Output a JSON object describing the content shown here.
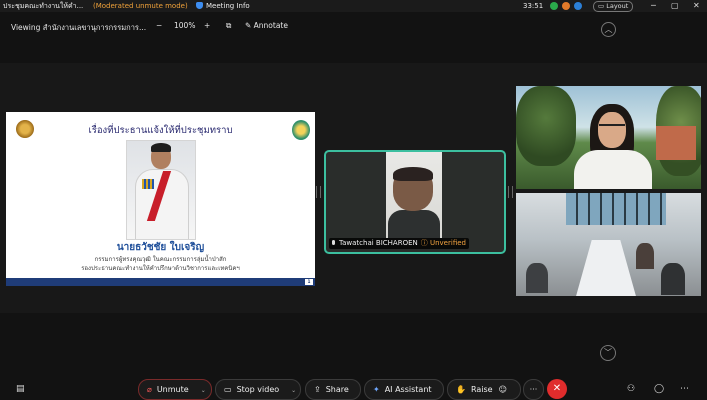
{
  "titlebar": {
    "meeting_title": "ประชุมคณะทำงานให้คำ...",
    "moderation": "(Moderated unmute mode)",
    "meeting_info": "Meeting Info",
    "time": "33:51",
    "layout": "Layout",
    "status_colors": [
      "#2aa94b",
      "#e27a2a",
      "#2b7fd6"
    ]
  },
  "sharebar": {
    "viewing": "Viewing สำนักงานเลขานุการกรรมการ...",
    "zoom_out": "−",
    "zoom": "100%",
    "zoom_in": "+",
    "annotate": "Annotate"
  },
  "slide": {
    "heading": "เรื่องที่ประธานแจ้งให้ที่ประชุมทราบ",
    "name": "นายธวัชชัย ใบเจริญ",
    "position_line1": "กรรมการผู้ทรงคุณวุฒิ ในคณะกรรมการลุ่มน้ำป่าสัก",
    "position_line2": "รองประธานคณะทำงานให้คำปรึกษาด้านวิชาการและเทคนิคฯ",
    "page": "1"
  },
  "participants": {
    "active_name": "Tawatchai BICHAROEN",
    "active_status": "Unverified"
  },
  "controls": {
    "unmute": "Unmute",
    "stop_video": "Stop video",
    "share": "Share",
    "ai_assistant": "AI Assistant",
    "raise": "Raise",
    "more": "···",
    "end": "✕"
  },
  "icons": {
    "mic_muted": "mic-off-icon",
    "camera": "camera-icon",
    "share": "share-icon",
    "ai": "ai-assistant-icon",
    "raise": "raise-hand-icon",
    "reactions": "emoji-icon",
    "participants": "participants-icon",
    "chat": "chat-icon",
    "more": "more-icon"
  },
  "accent": "#3cbf9f",
  "end_color": "#e02c2c",
  "warning_color": "#f0a23a"
}
